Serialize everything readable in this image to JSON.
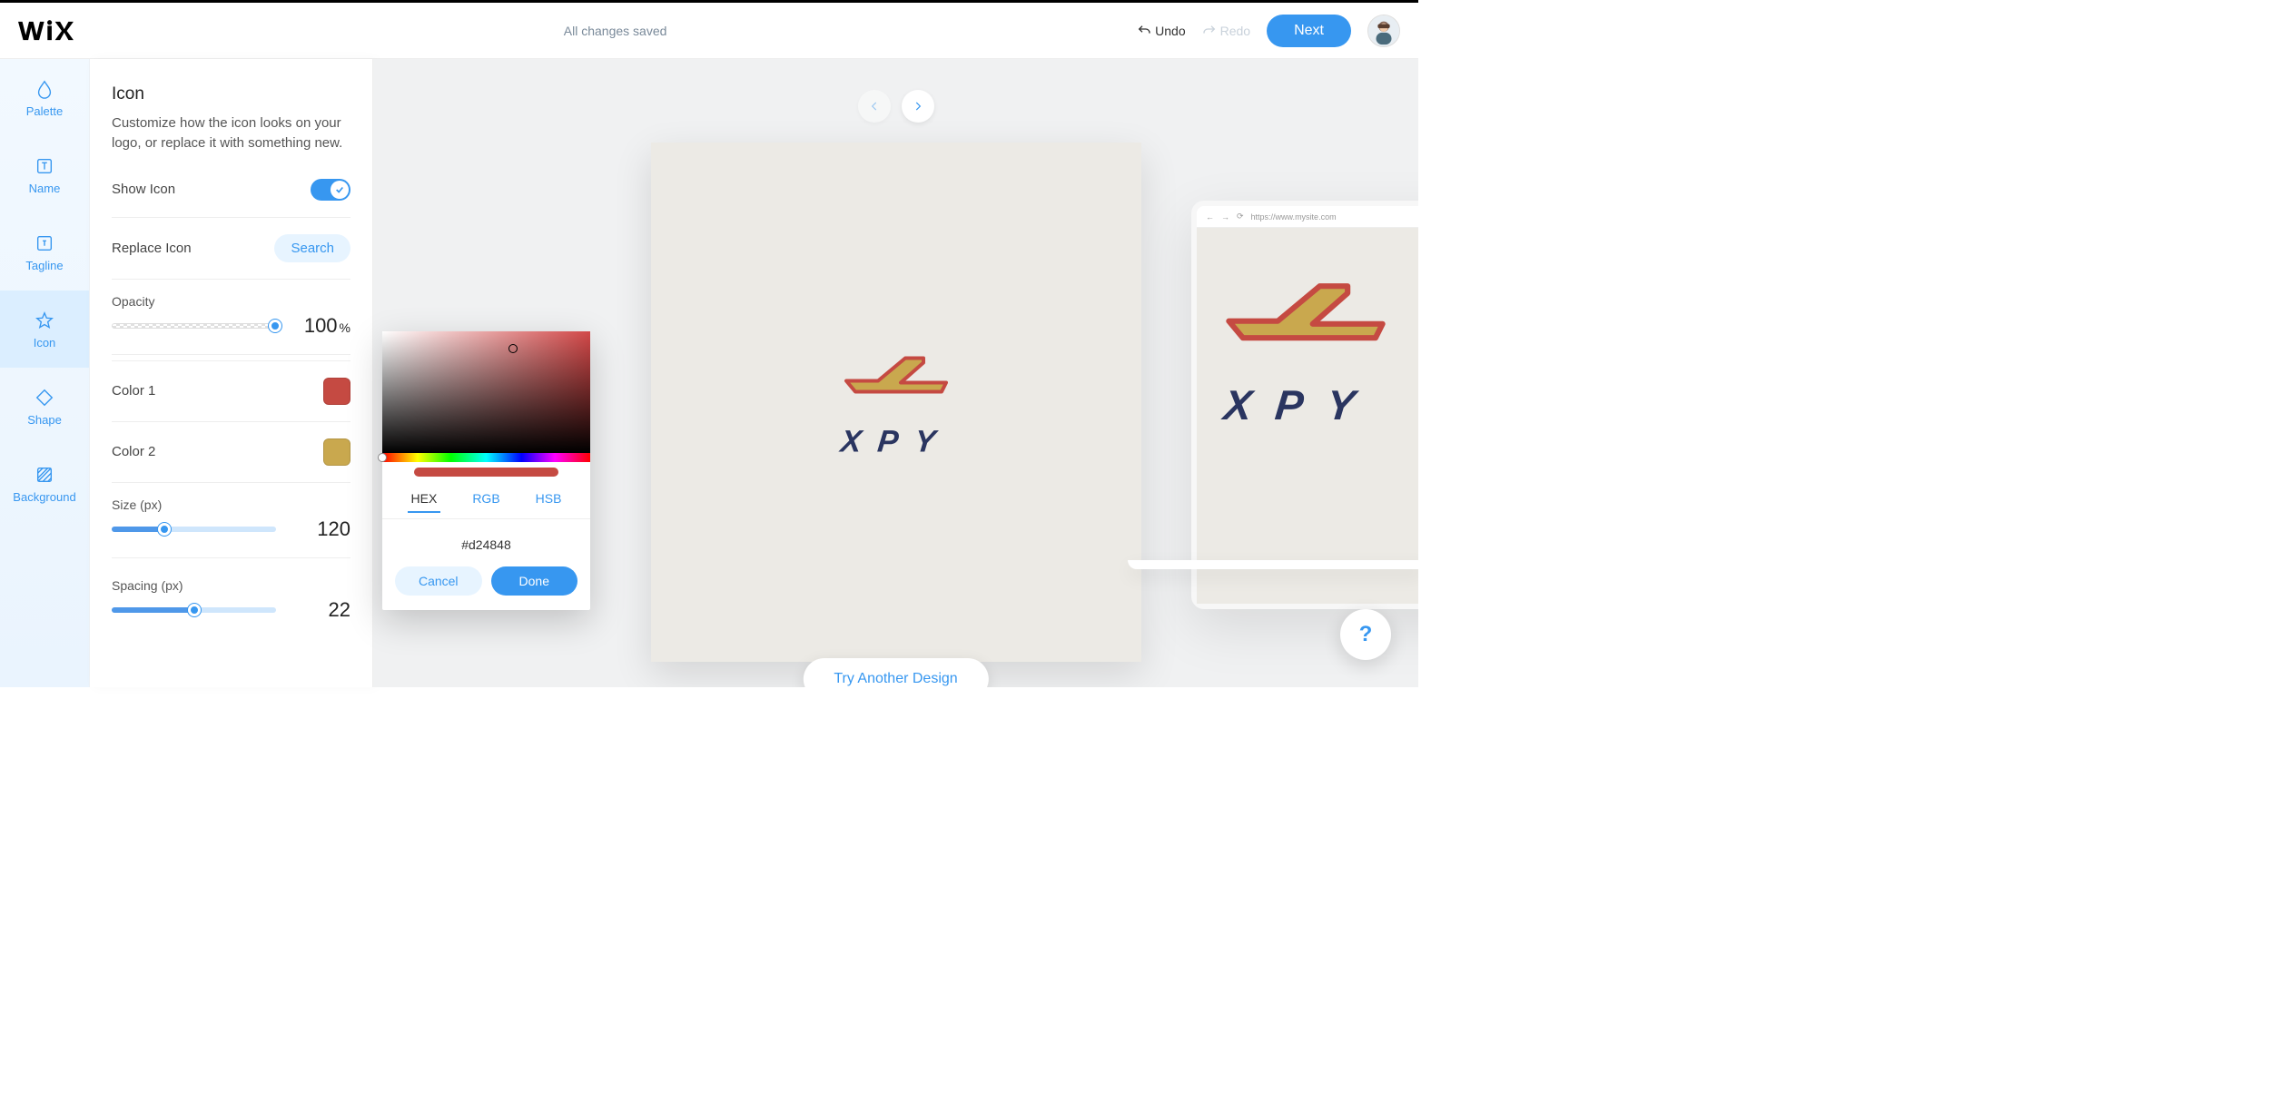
{
  "header": {
    "status": "All changes saved",
    "undo_label": "Undo",
    "redo_label": "Redo",
    "next_label": "Next"
  },
  "sidebar": {
    "items": [
      {
        "key": "palette",
        "label": "Palette"
      },
      {
        "key": "name",
        "label": "Name"
      },
      {
        "key": "tagline",
        "label": "Tagline"
      },
      {
        "key": "icon",
        "label": "Icon"
      },
      {
        "key": "shape",
        "label": "Shape"
      },
      {
        "key": "background",
        "label": "Background"
      }
    ],
    "active": "icon"
  },
  "panel": {
    "title": "Icon",
    "description": "Customize how the icon looks on your logo, or replace it with something new.",
    "show_icon_label": "Show Icon",
    "show_icon_on": true,
    "replace_icon_label": "Replace Icon",
    "search_label": "Search",
    "opacity": {
      "label": "Opacity",
      "value": 100,
      "suffix": "%"
    },
    "color1_label": "Color 1",
    "color1_value": "#c54a42",
    "color2_label": "Color 2",
    "color2_value": "#c9a84e",
    "size": {
      "label": "Size (px)",
      "value": 120
    },
    "spacing": {
      "label": "Spacing (px)",
      "value": 22
    }
  },
  "picker": {
    "tabs": [
      "HEX",
      "RGB",
      "HSB"
    ],
    "active_tab": "HEX",
    "hex_value": "#d24848",
    "cancel_label": "Cancel",
    "done_label": "Done"
  },
  "canvas": {
    "logo_text": "XPY",
    "try_another_label": "Try Another Design"
  },
  "device": {
    "url": "https://www.mysite.com"
  },
  "help_label": "?"
}
